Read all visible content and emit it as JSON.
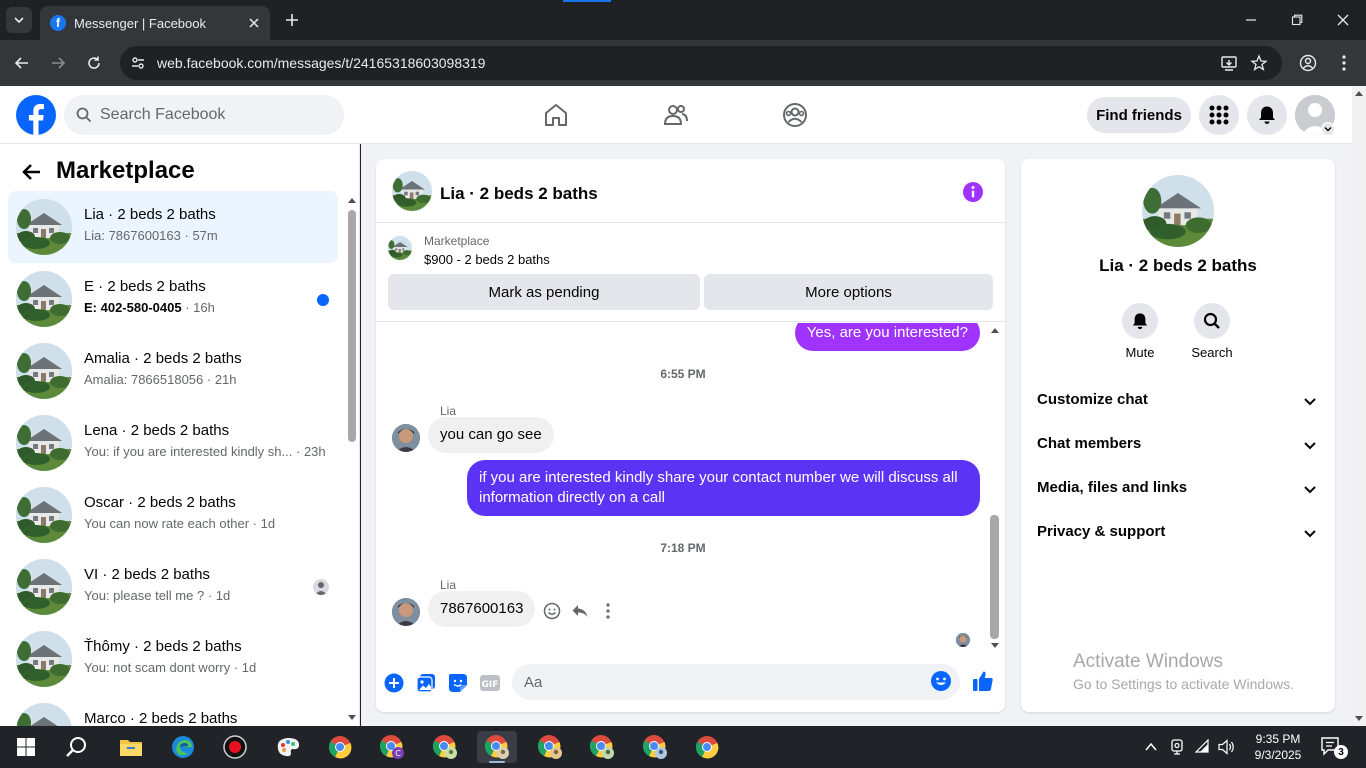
{
  "browser": {
    "tab_title": "Messenger | Facebook",
    "url": "web.facebook.com/messages/t/24165318603098319"
  },
  "header": {
    "search_placeholder": "Search Facebook",
    "find_friends": "Find friends"
  },
  "sidebar": {
    "title": "Marketplace",
    "conversations": [
      {
        "name": "Lia · 2 beds 2 baths",
        "preview": "Lia: 7867600163",
        "time": "57m",
        "active": true
      },
      {
        "name": "E · 2 beds 2 baths",
        "preview": "E: 402-580-0405",
        "time": "16h",
        "unread": true
      },
      {
        "name": "Amalia · 2 beds 2 baths",
        "preview": "Amalia: 7866518056",
        "time": "21h"
      },
      {
        "name": "Lena · 2 beds 2 baths",
        "preview": "You: if you are interested kindly sh...",
        "time": "23h"
      },
      {
        "name": "Oscar · 2 beds 2 baths",
        "preview": "You can now rate each other",
        "time": "1d"
      },
      {
        "name": "VI · 2 beds 2 baths",
        "preview": "You: please tell me ?",
        "time": "1d"
      },
      {
        "name": "Ťhômy · 2 beds 2 baths",
        "preview": "You: not scam dont worry",
        "time": "1d"
      },
      {
        "name": "Marco · 2 beds 2 baths",
        "preview": "",
        "time": ""
      }
    ]
  },
  "chat": {
    "title": "Lia · 2 beds 2 baths",
    "marketplace_label": "Marketplace",
    "listing": "$900 - 2 beds 2 baths",
    "mark_pending": "Mark as pending",
    "more_options": "More options",
    "messages": {
      "out_1": "Yes, are you interested?",
      "time_1": "6:55 PM",
      "sender_1": "Lia",
      "in_1": "you can go see",
      "out_2": "if you are interested kindly share your contact number we will discuss all information directly on a call",
      "time_2": "7:18 PM",
      "sender_2": "Lia",
      "in_2": "7867600163"
    },
    "composer_placeholder": "Aa"
  },
  "info_panel": {
    "name": "Lia · 2 beds 2 baths",
    "mute": "Mute",
    "search": "Search",
    "sections": [
      "Customize chat",
      "Chat members",
      "Media, files and links",
      "Privacy & support"
    ]
  },
  "watermark": {
    "title": "Activate Windows",
    "subtitle": "Go to Settings to activate Windows."
  },
  "taskbar": {
    "time": "9:35 PM",
    "date": "9/3/2025",
    "notifications": "3"
  },
  "colors": {
    "fb_blue": "#0866ff",
    "bubble_purple": "#a033ff",
    "bubble_violet": "#5b33f5",
    "info_purple": "#a033ff"
  }
}
